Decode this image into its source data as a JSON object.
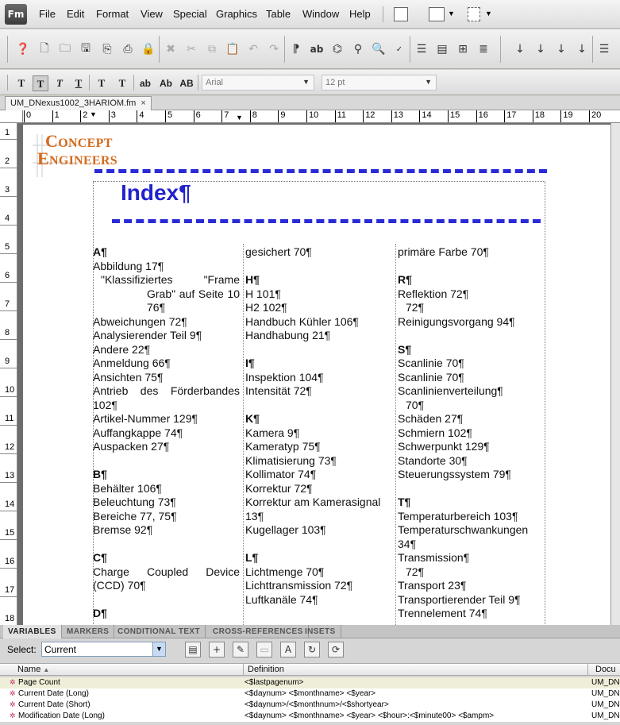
{
  "app": {
    "logo": "Fm"
  },
  "menu": [
    "File",
    "Edit",
    "Format",
    "View",
    "Special",
    "Graphics",
    "Table",
    "Window",
    "Help"
  ],
  "toolbar": {
    "font_name": "Arial",
    "font_size": "12 pt",
    "fmt_buttons": [
      "T",
      "T",
      "T",
      "T",
      "T",
      "T",
      "ab",
      "Ab",
      "AB"
    ]
  },
  "document": {
    "tab_title": "UM_DNexus1002_3HARIOM.fm",
    "tab_close": "×",
    "hruler": [
      "0",
      "1",
      "2",
      "3",
      "4",
      "5",
      "6",
      "7",
      "8",
      "9",
      "10",
      "11",
      "12",
      "13",
      "14",
      "15",
      "16",
      "17",
      "18",
      "19",
      "20"
    ],
    "vruler": [
      "1",
      "2",
      "3",
      "4",
      "5",
      "6",
      "7",
      "8",
      "9",
      "10",
      "11",
      "12",
      "13",
      "14",
      "15",
      "16",
      "17",
      "18"
    ],
    "logo_line1_big": "C",
    "logo_line1": "ONCEPT",
    "logo_line2_big": "E",
    "logo_line2": "NGINEERS",
    "title": "Index¶",
    "columns": [
      [
        {
          "t": "A¶",
          "c": "head"
        },
        {
          "t": "Abbildung 17¶"
        },
        {
          "t": "\"Klassifiziertes \"Frame",
          "c": "indent justify"
        },
        {
          "t": "Grab\" auf Seite 10",
          "c": "indent2 justify"
        },
        {
          "t": "76¶",
          "c": "indent2"
        },
        {
          "t": "Abweichungen 72¶"
        },
        {
          "t": "Analysierender Teil 9¶"
        },
        {
          "t": "Andere 22¶"
        },
        {
          "t": "Anmeldung 66¶"
        },
        {
          "t": "Ansichten 75¶"
        },
        {
          "t": "Antrieb des Förderbandes",
          "c": "justify"
        },
        {
          "t": "102¶"
        },
        {
          "t": "Artikel-Nummer 129¶"
        },
        {
          "t": "Auffangkappe 74¶"
        },
        {
          "t": "Auspacken 27¶"
        },
        {
          "t": ""
        },
        {
          "t": "B¶",
          "c": "head"
        },
        {
          "t": "Behälter 106¶"
        },
        {
          "t": "Beleuchtung 73¶"
        },
        {
          "t": "Bereiche 77, 75¶"
        },
        {
          "t": "Bremse 92¶"
        },
        {
          "t": ""
        },
        {
          "t": "C¶",
          "c": "head"
        },
        {
          "t": "Charge Coupled Device",
          "c": "justify"
        },
        {
          "t": "(CCD) 70¶"
        },
        {
          "t": ""
        },
        {
          "t": "D¶",
          "c": "head"
        }
      ],
      [
        {
          "t": "gesichert 70¶"
        },
        {
          "t": ""
        },
        {
          "t": "H¶",
          "c": "head"
        },
        {
          "t": "H 101¶"
        },
        {
          "t": "H2 102¶"
        },
        {
          "t": "Handbuch Kühler 106¶"
        },
        {
          "t": "Handhabung 21¶"
        },
        {
          "t": ""
        },
        {
          "t": "I¶",
          "c": "head"
        },
        {
          "t": "Inspektion 104¶"
        },
        {
          "t": "Intensität 72¶"
        },
        {
          "t": ""
        },
        {
          "t": "K¶",
          "c": "head"
        },
        {
          "t": "Kamera 9¶"
        },
        {
          "t": "Kameratyp 75¶"
        },
        {
          "t": "Klimatisierung 73¶"
        },
        {
          "t": "Kollimator 74¶"
        },
        {
          "t": "Korrektur 72¶"
        },
        {
          "t": "Korrektur am Kamerasignal"
        },
        {
          "t": "13¶"
        },
        {
          "t": "Kugellager 103¶"
        },
        {
          "t": ""
        },
        {
          "t": "L¶",
          "c": "head"
        },
        {
          "t": "Lichtmenge 70¶"
        },
        {
          "t": "Lichttransmission 72¶"
        },
        {
          "t": "Luftkanäle 74¶"
        }
      ],
      [
        {
          "t": "primäre Farbe 70¶"
        },
        {
          "t": ""
        },
        {
          "t": "R¶",
          "c": "head"
        },
        {
          "t": "Reflektion 72¶"
        },
        {
          "t": "72¶",
          "c": "indent"
        },
        {
          "t": "Reinigungsvorgang 94¶"
        },
        {
          "t": ""
        },
        {
          "t": "S¶",
          "c": "head"
        },
        {
          "t": "Scanlinie 70¶"
        },
        {
          "t": "Scanlinie 70¶"
        },
        {
          "t": "Scanlinienverteilung¶"
        },
        {
          "t": "70¶",
          "c": "indent"
        },
        {
          "t": "Schäden 27¶"
        },
        {
          "t": "Schmiern 102¶"
        },
        {
          "t": "Schwerpunkt 129¶"
        },
        {
          "t": "Standorte 30¶"
        },
        {
          "t": "Steuerungssystem 79¶"
        },
        {
          "t": ""
        },
        {
          "t": "T¶",
          "c": "head"
        },
        {
          "t": "Temperaturbereich 103¶"
        },
        {
          "t": "Temperaturschwankungen"
        },
        {
          "t": "34¶"
        },
        {
          "t": "Transmission¶"
        },
        {
          "t": "72¶",
          "c": "indent"
        },
        {
          "t": "Transport 23¶"
        },
        {
          "t": "Transportierender Teil 9¶"
        },
        {
          "t": "Trennelement 74¶"
        }
      ]
    ]
  },
  "panel": {
    "tabs": [
      "VARIABLES",
      "MARKERS",
      "CONDITIONAL TEXT",
      "CROSS-REFERENCES",
      "INSETS"
    ],
    "select_label": "Select:",
    "select_value": "Current",
    "col_name": "Name",
    "col_definition": "Definition",
    "col_document": "Docu",
    "rows": [
      {
        "name": "Page Count",
        "definition": "<$lastpagenum>",
        "doc": "UM_DN"
      },
      {
        "name": "Current Date (Long)",
        "definition": "<$daynum> <$monthname> <$year>",
        "doc": "UM_DN"
      },
      {
        "name": "Current Date (Short)",
        "definition": "<$daynum>/<$monthnum>/<$shortyear>",
        "doc": "UM_DN"
      },
      {
        "name": "Modification Date (Long)",
        "definition": "<$daynum> <$monthname> <$year> <$hour>:<$minute00> <$ampm>",
        "doc": "UM_DN"
      }
    ]
  }
}
